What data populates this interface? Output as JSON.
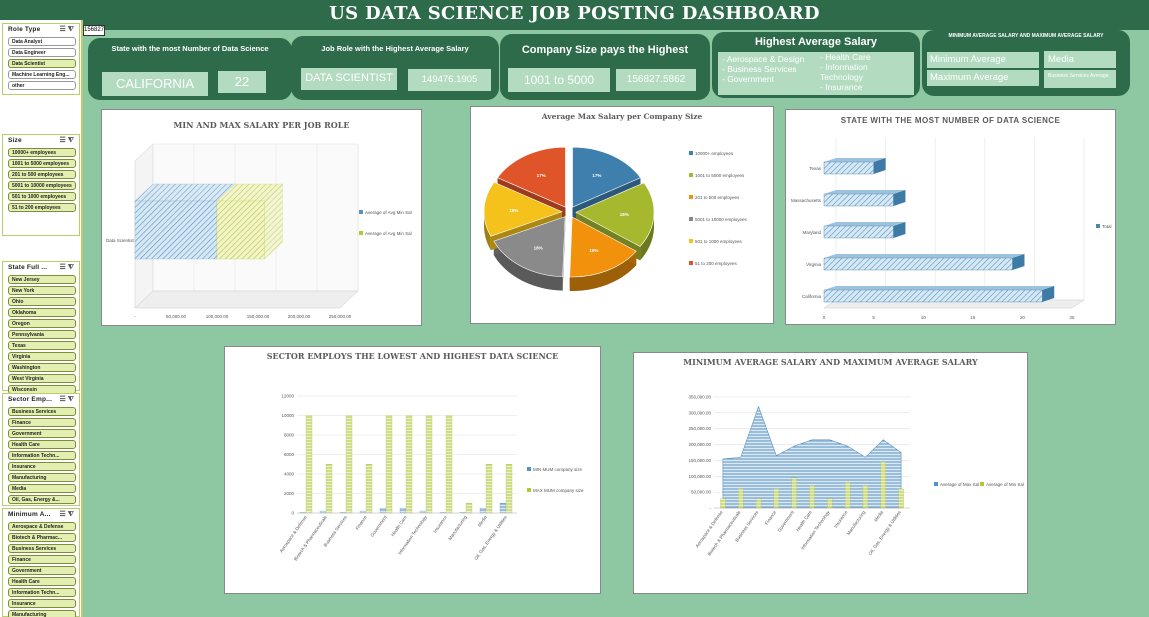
{
  "title": "US DATA SCIENCE JOB POSTING DASHBOARD",
  "cell_value": "156827",
  "slicers": {
    "role": {
      "header": "Role Type",
      "items": [
        "Data Analyst",
        "Data Engineer",
        "Data Scientist",
        "Machine Learning Eng...",
        "other"
      ]
    },
    "size": {
      "header": "Size",
      "items": [
        "10000+ employees",
        "1001 to 5000 employees",
        "201 to 500 employees",
        "5001 to 10000 employees",
        "501 to 1000 employees",
        "51 to 200 employees"
      ]
    },
    "state": {
      "header": "State Full ...",
      "items": [
        "New Jersey",
        "New York",
        "Ohio",
        "Oklahoma",
        "Oregon",
        "Pennsylvania",
        "Texas",
        "Virginia",
        "Washington",
        "West Virginia",
        "Wisconsin"
      ]
    },
    "sector": {
      "header": "Sector Emp...",
      "items": [
        "Business Services",
        "Finance",
        "Government",
        "Health Care",
        "Information Techn...",
        "Insurance",
        "Manufacturing",
        "Media",
        "Oil, Gas, Energy &..."
      ]
    },
    "minimum": {
      "header": "Minimum A...",
      "items": [
        "Aerospace & Defense",
        "Biotech & Pharmac...",
        "Business Services",
        "Finance",
        "Government",
        "Health Care",
        "Information Techn...",
        "Insurance",
        "Manufacturing"
      ]
    }
  },
  "kpi": {
    "state": {
      "caption": "State with the most Number of Data Science",
      "name": "CALIFORNIA",
      "count": "22"
    },
    "role": {
      "caption": "Job Role with the Highest Average Salary",
      "name": "DATA SCIENTIST",
      "value": "149476.1905"
    },
    "company": {
      "caption": "Company Size pays the Highest",
      "name": "1001 to 5000",
      "value": "156827.5862"
    },
    "sector": {
      "caption": "Highest Average Salary",
      "left": [
        "- Aerospace & Design",
        "- Business Services",
        "- Government"
      ],
      "right": [
        "- Health Care",
        "- Information",
        "Technology",
        "- Insurance"
      ]
    },
    "minmax": {
      "caption": "MINIMUM AVERAGE SALARY AND MAXIMUM AVERAGE SALARY",
      "min_label": "Minimum Average",
      "max_label": "Maximum Average",
      "min_value": "Media",
      "max_value": "Business Services Average"
    }
  },
  "colors": {
    "dark_green": "#2e6b4a",
    "tile": "#b3dbc0",
    "blue": "#4a86b0",
    "olive": "#c5d13a"
  },
  "charts": {
    "c1": {
      "title": "MIN AND MAX SALARY PER JOB ROLE"
    },
    "c2": {
      "title": "Average Max Salary per Company Size"
    },
    "c3": {
      "title": "STATE WITH THE MOST NUMBER OF DATA SCIENCE"
    },
    "c4": {
      "title": "SECTOR EMPLOYS THE LOWEST AND HIGHEST DATA SCIENCE"
    },
    "c5": {
      "title": "MINIMUM AVERAGE SALARY AND MAXIMUM AVERAGE SALARY"
    }
  },
  "chart_data": [
    {
      "type": "bar",
      "title": "MIN AND MAX SALARY PER JOB ROLE",
      "categories": [
        "Data Scientist"
      ],
      "series": [
        {
          "name": "Average of Avg Min Sal",
          "values": [
            100000
          ]
        },
        {
          "name": "Average of Avg Min Sal",
          "values": [
            58000
          ]
        }
      ],
      "xticks": [
        "-",
        "50,000.00",
        "100,000.00",
        "150,000.00",
        "200,000.00",
        "250,000.00"
      ],
      "xlim": [
        0,
        250000
      ]
    },
    {
      "type": "pie",
      "title": "Average Max Salary per Company Size",
      "labels": [
        "10000+ employees",
        "1001 to 5000 employees",
        "201 to 500 employees",
        "5001 to 10000 employees",
        "501 to 1000 employees",
        "51 to 200 employees"
      ],
      "values": [
        17,
        18,
        16,
        18,
        15,
        17
      ],
      "display": [
        "17%",
        "18%",
        "16%",
        "18%",
        "15%",
        "17%"
      ],
      "colors": [
        "#3f7fae",
        "#a6b82e",
        "#f2920c",
        "#8a8a8a",
        "#f5c21b",
        "#e0542a"
      ]
    },
    {
      "type": "bar",
      "title": "STATE WITH THE MOST NUMBER OF DATA SCIENCE",
      "categories": [
        "Texas",
        "Massachusetts",
        "Maryland",
        "Virginia",
        "California"
      ],
      "values": [
        5,
        7,
        7,
        19,
        22
      ],
      "series_name": "Total",
      "xticks": [
        "0",
        "5",
        "10",
        "15",
        "20",
        "25"
      ],
      "xlim": [
        0,
        25
      ]
    },
    {
      "type": "bar",
      "title": "SECTOR EMPLOYS THE LOWEST AND HIGHEST DATA SCIENCE",
      "categories": [
        "Aerospace & Defense",
        "Biotech & Pharmaceuticals",
        "Business Services",
        "Finance",
        "Government",
        "Health Care",
        "Information Technology",
        "Insurance",
        "Manufacturing",
        "Media",
        "Oil, Gas, Energy & Utilities"
      ],
      "series": [
        {
          "name": "MIN MUM company size",
          "values": [
            51,
            201,
            51,
            201,
            501,
            501,
            201,
            51,
            51,
            501,
            1001
          ]
        },
        {
          "name": "MAX MUM company size",
          "values": [
            10000,
            5000,
            10000,
            5000,
            10000,
            10000,
            10000,
            10000,
            1000,
            5000,
            5000
          ]
        }
      ],
      "yticks": [
        "0",
        "2000",
        "4000",
        "6000",
        "8000",
        "10000",
        "12000"
      ],
      "ylim": [
        0,
        12000
      ]
    },
    {
      "type": "area",
      "title": "MINIMUM AVERAGE SALARY AND MAXIMUM AVERAGE SALARY",
      "categories": [
        "Aerospace & Defense",
        "Biotech & Pharmaceuticals",
        "Business Services",
        "Finance",
        "Government",
        "Health Care",
        "Information Technology",
        "Insurance",
        "Manufacturing",
        "Media",
        "Oil, Gas, Energy & Utilities"
      ],
      "series": [
        {
          "name": "Average of Max Sal",
          "type": "area",
          "values": [
            155000,
            160000,
            320000,
            165000,
            195000,
            215000,
            215000,
            195000,
            160000,
            215000,
            175000
          ]
        },
        {
          "name": "Average of Min Sal",
          "type": "bar",
          "values": [
            30000,
            60000,
            30000,
            60000,
            95000,
            70000,
            30000,
            80000,
            70000,
            145000,
            60000
          ]
        }
      ],
      "yticks": [
        "-",
        "50,000.00",
        "100,000.00",
        "150,000.00",
        "200,000.00",
        "250,000.00",
        "300,000.00",
        "350,000.00"
      ],
      "ylim": [
        0,
        350000
      ]
    }
  ]
}
